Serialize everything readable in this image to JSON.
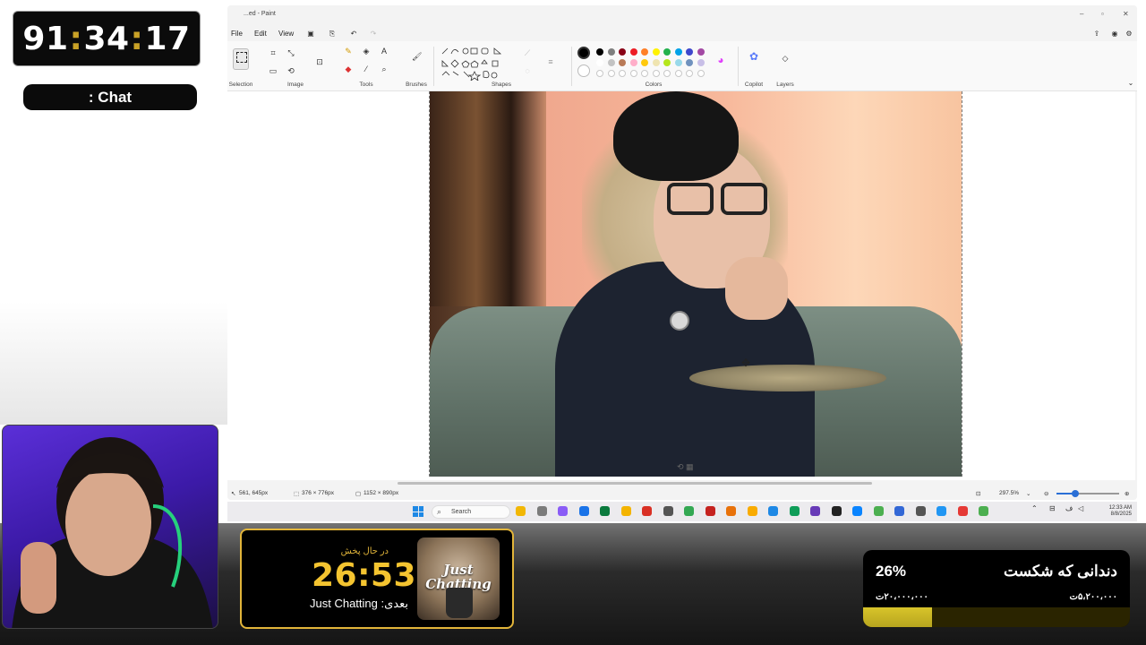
{
  "stream": {
    "timer": {
      "hh": "91",
      "mm": "34",
      "ss": "17",
      "sep": ":"
    },
    "chat_label": ": Chat",
    "now_playing": {
      "live_label": "در حال پخش",
      "time": "26:53",
      "next_label": "Just Chatting :بعدی",
      "thumbnail_text": "Just Chatting"
    },
    "goal": {
      "title": "دندانی که شکست",
      "percent_label": "26%",
      "percent": 26,
      "current": "۵،۲۰۰،۰۰۰ت",
      "target": "۲۰،۰۰۰،۰۰۰ت"
    }
  },
  "paint": {
    "title": "...ed - Paint",
    "menu": {
      "file": "File",
      "edit": "Edit",
      "view": "View"
    },
    "ribbon": {
      "groups": [
        "Selection",
        "Image",
        "Tools",
        "Brushes",
        "Shapes",
        "Colors",
        "Copilot",
        "Layers"
      ]
    },
    "colors": {
      "primary": "#000000",
      "secondary": "#ffffff",
      "row1": [
        "#000000",
        "#7f7f7f",
        "#880015",
        "#ed1c24",
        "#ff7f27",
        "#fff200",
        "#22b14c",
        "#00a2e8",
        "#3f48cc",
        "#a349a4"
      ],
      "row2": [
        "#ffffff",
        "#c3c3c3",
        "#b97a57",
        "#ffaec9",
        "#ffc90e",
        "#efe4b0",
        "#b5e61d",
        "#99d9ea",
        "#7092be",
        "#c8bfe7"
      ]
    },
    "status": {
      "cursor_pos": "561, 645px",
      "selection_size": "376 × 776px",
      "image_size": "1152 × 890px",
      "zoom": "297.5%",
      "zoom_level": 0.3
    }
  },
  "taskbar": {
    "search_placeholder": "Search",
    "clock_time": "12:33 AM",
    "clock_date": "8/8/2025"
  }
}
